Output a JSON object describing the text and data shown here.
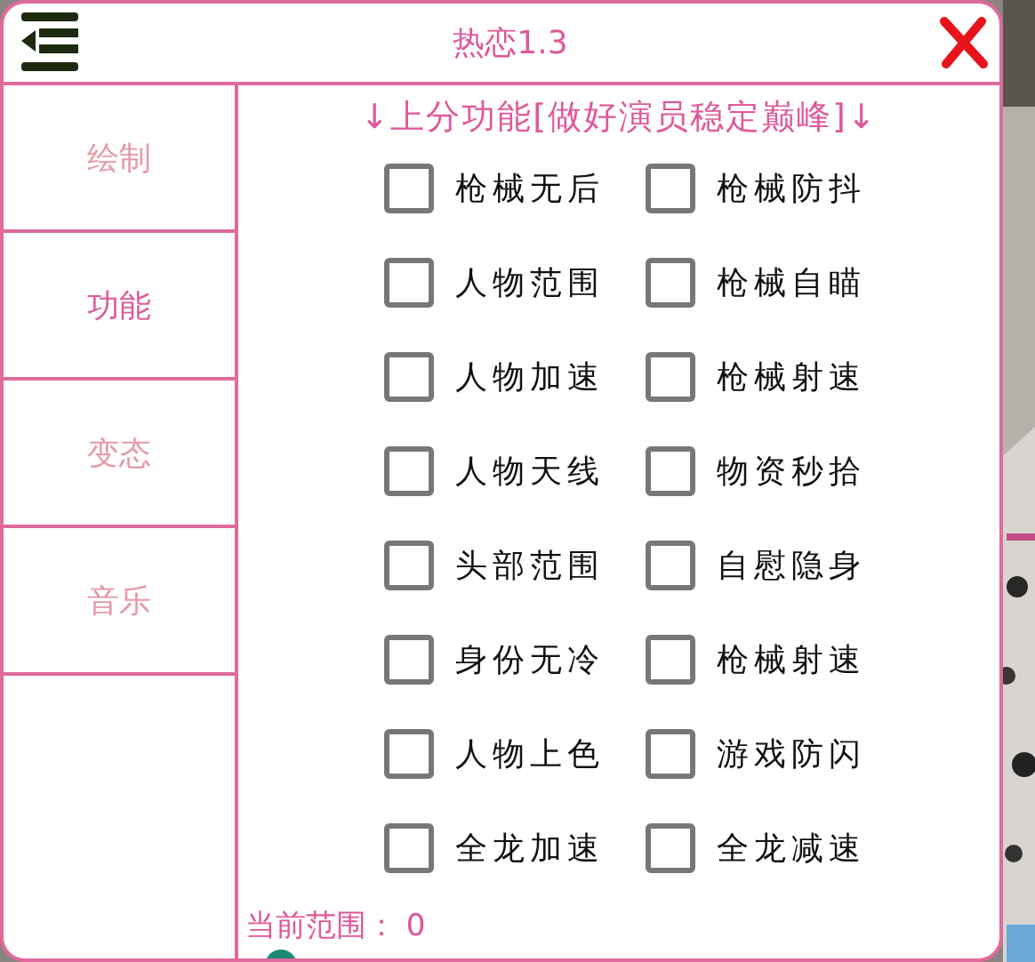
{
  "window": {
    "title": "热恋1.3"
  },
  "sidebar": {
    "items": [
      {
        "label": "绘制",
        "selected": false
      },
      {
        "label": "功能",
        "selected": true
      },
      {
        "label": "变态",
        "selected": false
      },
      {
        "label": "音乐",
        "selected": false
      }
    ]
  },
  "section_heading": "↓上分功能[做好演员稳定巅峰]↓",
  "options": [
    {
      "label": "枪械无后",
      "checked": false
    },
    {
      "label": "枪械防抖",
      "checked": false
    },
    {
      "label": "人物范围",
      "checked": false
    },
    {
      "label": "枪械自瞄",
      "checked": false
    },
    {
      "label": "人物加速",
      "checked": false
    },
    {
      "label": "枪械射速",
      "checked": false
    },
    {
      "label": "人物天线",
      "checked": false
    },
    {
      "label": "物资秒拾",
      "checked": false
    },
    {
      "label": "头部范围",
      "checked": false
    },
    {
      "label": "自慰隐身",
      "checked": false
    },
    {
      "label": "身份无冷",
      "checked": false
    },
    {
      "label": "枪械射速",
      "checked": false
    },
    {
      "label": "人物上色",
      "checked": false
    },
    {
      "label": "游戏防闪",
      "checked": false
    },
    {
      "label": "全龙加速",
      "checked": false
    },
    {
      "label": "全龙减速",
      "checked": false
    }
  ],
  "range": {
    "label": "当前范围： 0",
    "level": 0
  }
}
